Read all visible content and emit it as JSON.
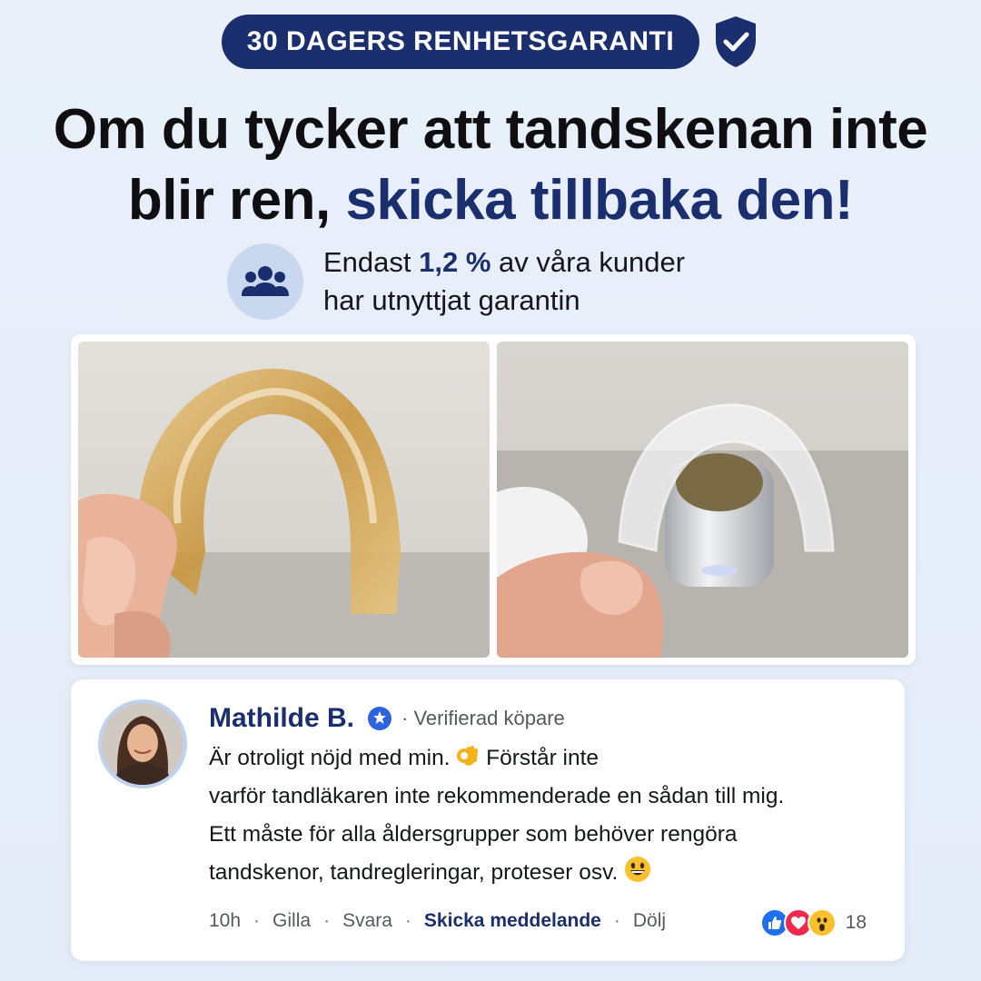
{
  "badge": {
    "text": "30 DAGERS RENHETSGARANTI",
    "icon": "shield-check-icon"
  },
  "headline": {
    "line1": "Om du tycker att tandskenan inte",
    "line2_plain": "blir ren,",
    "line2_accent": "skicka tillbaka den!"
  },
  "stat": {
    "icon": "users-group-icon",
    "prefix": "Endast",
    "value": "1,2 %",
    "suffix": "av våra kunder",
    "line2": "har utnyttjat garantin"
  },
  "photos": {
    "before_icon": "stained-aligner-photo",
    "after_icon": "clean-aligner-photo"
  },
  "review": {
    "name": "Mathilde B.",
    "verified": "· Verifierad köpare",
    "line1": "Är otroligt nöjd med min.",
    "line1_tail": "Förstår inte",
    "line2": "varför tandläkaren inte rekommenderade en sådan till mig.",
    "line3": "Ett måste för alla åldersgrupper som behöver rengöra",
    "line4": "tandskenor, tandregleringar, proteser osv.",
    "time": "10h",
    "like": "Gilla",
    "reply": "Svara",
    "message": "Skicka meddelande",
    "hide": "Dölj",
    "sep": "·",
    "reaction_count": "18"
  },
  "colors": {
    "accent": "#1b2f6e",
    "background": "#e7eef9"
  }
}
